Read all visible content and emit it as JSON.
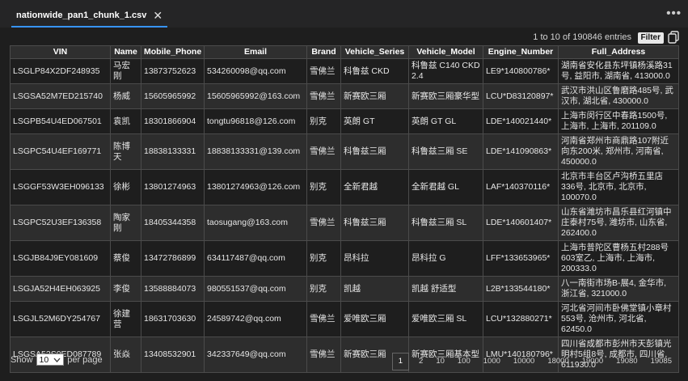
{
  "tab": {
    "title": "nationwide_pan1_chunk_1.csv",
    "close_label": "✕"
  },
  "toolbar": {
    "more_label": "•••"
  },
  "info": {
    "entries_text": "1 to 10 of 190846 entries",
    "filter_label": "Filter"
  },
  "table": {
    "columns": [
      "VIN",
      "Name",
      "Mobile_Phone",
      "Email",
      "Brand",
      "Vehicle_Series",
      "Vehicle_Model",
      "Engine_Number",
      "Full_Address"
    ],
    "rows": [
      [
        "LSGLP84X2DF248935",
        "马宏刚",
        "13873752623",
        "534260098@qq.com",
        "雪佛兰",
        "科鲁兹 CKD",
        "科鲁兹 C140 CKD 2.4",
        "LE9*140800786*",
        "湖南省安化县东坪镇杨溪路31号, 益阳市, 湖南省, 413000.0"
      ],
      [
        "LSGSA52M7ED215740",
        "杨威",
        "15605965992",
        "15605965992@163.com",
        "雪佛兰",
        "新赛欧三厢",
        "新赛欧三厢豪华型",
        "LCU*D83120897*",
        "武汉市洪山区鲁磨路485号, 武汉市, 湖北省, 430000.0"
      ],
      [
        "LSGPB54U4ED067501",
        "袁凯",
        "18301866904",
        "tongtu96818@126.com",
        "别克",
        "英朗 GT",
        "英朗 GT GL",
        "LDE*140021440*",
        "上海市闵行区中春路1500号, 上海市, 上海市, 201109.0"
      ],
      [
        "LSGPC54U4EF169771",
        "陈博天",
        "18838133331",
        "18838133331@139.com",
        "雪佛兰",
        "科鲁兹三厢",
        "科鲁兹三厢 SE",
        "LDE*141090863*",
        "河南省郑州市商鼎路107附近向东200米, 郑州市, 河南省, 450000.0"
      ],
      [
        "LSGGF53W3EH096133",
        "徐彬",
        "13801274963",
        "13801274963@126.com",
        "别克",
        "全新君越",
        "全新君越 GL",
        "LAF*140370116*",
        "北京市丰台区卢沟桥五里店336号, 北京市, 北京市, 100070.0"
      ],
      [
        "LSGPC52U3EF136358",
        "陶家刚",
        "18405344358",
        "taosugang@163.com",
        "雪佛兰",
        "科鲁兹三厢",
        "科鲁兹三厢 SL",
        "LDE*140601407*",
        "山东省潍坊市昌乐县红河镇中庄泰村75号, 潍坊市, 山东省, 262400.0"
      ],
      [
        "LSGJB84J9EY081609",
        "蔡俊",
        "13472786899",
        "634117487@qq.com",
        "别克",
        "昂科拉",
        "昂科拉 G",
        "LFF*133653965*",
        "上海市普陀区曹杨五村288号603室乙, 上海市, 上海市, 200333.0"
      ],
      [
        "LSGJA52H4EH063925",
        "李俊",
        "13588884073",
        "980551537@qq.com",
        "别克",
        "凯越",
        "凯越 舒适型",
        "L2B*133544180*",
        "八一南街市场B-展4, 金华市, 浙江省, 321000.0"
      ],
      [
        "LSGJL52M6DY254767",
        "徐建营",
        "18631703630",
        "24589742@qq.com",
        "雪佛兰",
        "爱唯欧三厢",
        "爱唯欧三厢 SL",
        "LCU*132880271*",
        "河北省河间市卧佛堂镇小章村553号, 沧州市, 河北省, 62450.0"
      ],
      [
        "LSGSA52S0ED087789",
        "张焱",
        "13408532901",
        "342337649@qq.com",
        "雪佛兰",
        "新赛欧三厢",
        "新赛欧三厢基本型",
        "LMU*140180796*",
        "四川省成都市彭州市天彭镇光明村5组8号, 成都市, 四川省, 611930.0"
      ]
    ]
  },
  "footer": {
    "show_label": "Show",
    "page_size": "10",
    "per_page_label": "per page"
  },
  "pagination": [
    "1",
    "2",
    "10",
    "100",
    "1000",
    "10000",
    "18000",
    "19000",
    "19080",
    "19085"
  ],
  "current_page": "1",
  "colors": {
    "background": "#1e1e1e",
    "tab_accent": "#3794ff",
    "row_alt": "#2d2d2d",
    "border": "#4b4b4b"
  },
  "icons": {
    "close": "close-icon",
    "more": "more-icon",
    "copy": "copy-icon",
    "dropdown": "chevron-down-icon"
  }
}
